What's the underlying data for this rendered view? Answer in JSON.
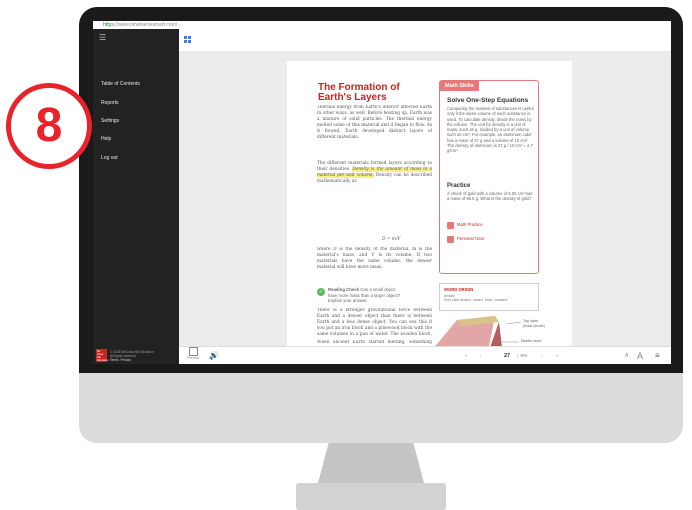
{
  "browser": {
    "protocol": "https",
    "url": "://www.mhebarnesmart.com/..."
  },
  "sidebar": {
    "items": [
      {
        "label": "Table of Contents"
      },
      {
        "label": "Reports"
      },
      {
        "label": "Settings"
      },
      {
        "label": "Help"
      },
      {
        "label": "Log out"
      }
    ],
    "logo_text": "Mc Graw Hill Education",
    "copyright": "© 2018 McGraw-Hill Education",
    "rights": "All rights reserved.",
    "links": [
      "Terms",
      "Privacy"
    ]
  },
  "badge": {
    "number": "8"
  },
  "page": {
    "title_line1": "The Formation of",
    "title_line2": "Earth's Layers",
    "para1": "Thermal energy from Earth's interior affected Earth in other ways, as well. Before heating up, Earth was a mixture of solid particles. The thermal energy melted some of this material and it began to flow. As it flowed, Earth developed distinct layers of different materials.",
    "para2_pre": "The different materials formed layers according to their densities.",
    "para2_hl": "Density is the amount of mass in a material per unit volume.",
    "para2_post": "Density can be described mathematically as",
    "equation": "D = m/V",
    "para3": "where D is the density of the material, m is the material's mass, and V is its volume. If two materials have the same volume, the denser material will have more mass.",
    "reading_check_title": "Reading Check",
    "reading_check_text": "Can a small object have more mass than a larger object? Explain your answer.",
    "para4": "There is a stronger gravitational force between Earth and a denser object than there is between Earth and a less dense object. You can see this if you put an iron block and a pinewood block with the same volumes in a pan of water. The wooden block, which is less dense than water, will float on the water's surface. The iron block, which is denser than water, will be pulled through the water to the bottom of the pan.",
    "para5": "When ancient Earth started melting, something much like this happened. The densest"
  },
  "math_skills": {
    "tag": "Math Skills",
    "title": "Solve One-Step Equations",
    "body": "Comparing the masses of substances is useful only if the same volume of each substance is used. To calculate density, divide the mass by the volume. The unit for density is a unit of mass, such as g, divided by a unit of volume, such as cm³. For example, an aluminum cube has a mass of 27 g and a volume of 10 cm³. The density of aluminum is 27 g / 10 cm³ = 2.7 g/cm³.",
    "practice_title": "Practice",
    "practice_body": "A chunk of gold with a volume of 5.00 cm³ has a mass of 96.5 g. What is the density of gold?",
    "link1": "Math Practice",
    "link2": "Personal Tutor"
  },
  "word_origin": {
    "title": "WORD ORIGIN",
    "word": "density",
    "origin": "from Latin densus, means \"thick, crowded\""
  },
  "figure": {
    "label1": "Top layer",
    "label1b": "(least dense)",
    "label2": "Middle layer"
  },
  "toolbar": {
    "preview_label": "Preview",
    "current_page": "27",
    "total_pages": "/ 499",
    "font_small": "A",
    "font_large": "A"
  },
  "colors": {
    "accent_red": "#c8241f",
    "math_pink": "#e9787b",
    "highlight": "#f5f081",
    "badge_red": "#e8232a"
  }
}
